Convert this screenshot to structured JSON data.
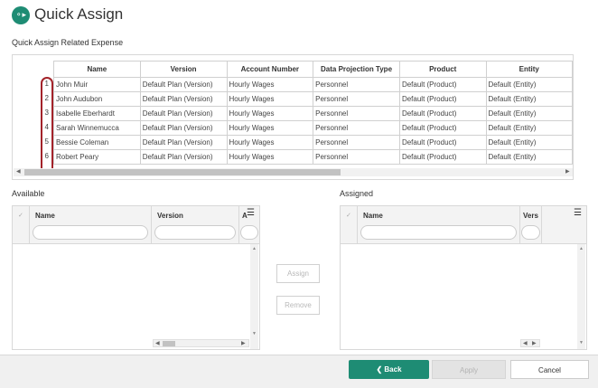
{
  "app": {
    "title": "Quick Assign",
    "icon": "flow-icon"
  },
  "related": {
    "label": "Quick Assign Related Expense",
    "columns": [
      "Name",
      "Version",
      "Account Number",
      "Data Projection Type",
      "Product",
      "Entity"
    ],
    "rows": [
      {
        "num": "1",
        "cells": [
          "John Muir",
          "Default Plan (Version)",
          "Hourly Wages",
          "Personnel",
          "Default (Product)",
          "Default (Entity)"
        ]
      },
      {
        "num": "2",
        "cells": [
          "John Audubon",
          "Default Plan (Version)",
          "Hourly Wages",
          "Personnel",
          "Default (Product)",
          "Default (Entity)"
        ]
      },
      {
        "num": "3",
        "cells": [
          "Isabelle Eberhardt",
          "Default Plan (Version)",
          "Hourly Wages",
          "Personnel",
          "Default (Product)",
          "Default (Entity)"
        ]
      },
      {
        "num": "4",
        "cells": [
          "Sarah Winnemucca",
          "Default Plan (Version)",
          "Hourly Wages",
          "Personnel",
          "Default (Product)",
          "Default (Entity)"
        ]
      },
      {
        "num": "5",
        "cells": [
          "Bessie Coleman",
          "Default Plan (Version)",
          "Hourly Wages",
          "Personnel",
          "Default (Product)",
          "Default (Entity)"
        ]
      },
      {
        "num": "6",
        "cells": [
          "Robert Peary",
          "Default Plan (Version)",
          "Hourly Wages",
          "Personnel",
          "Default (Product)",
          "Default (Entity)"
        ]
      }
    ]
  },
  "available": {
    "label": "Available",
    "col_name": "Name",
    "col_version": "Version",
    "col_partial": "A"
  },
  "assigned": {
    "label": "Assigned",
    "col_name": "Name",
    "col_version": "Vers"
  },
  "middle": {
    "assign": "Assign",
    "remove": "Remove"
  },
  "footer": {
    "back": "Back",
    "apply": "Apply",
    "cancel": "Cancel"
  },
  "colors": {
    "accent": "#1e8c74",
    "highlight": "#a3232a"
  }
}
